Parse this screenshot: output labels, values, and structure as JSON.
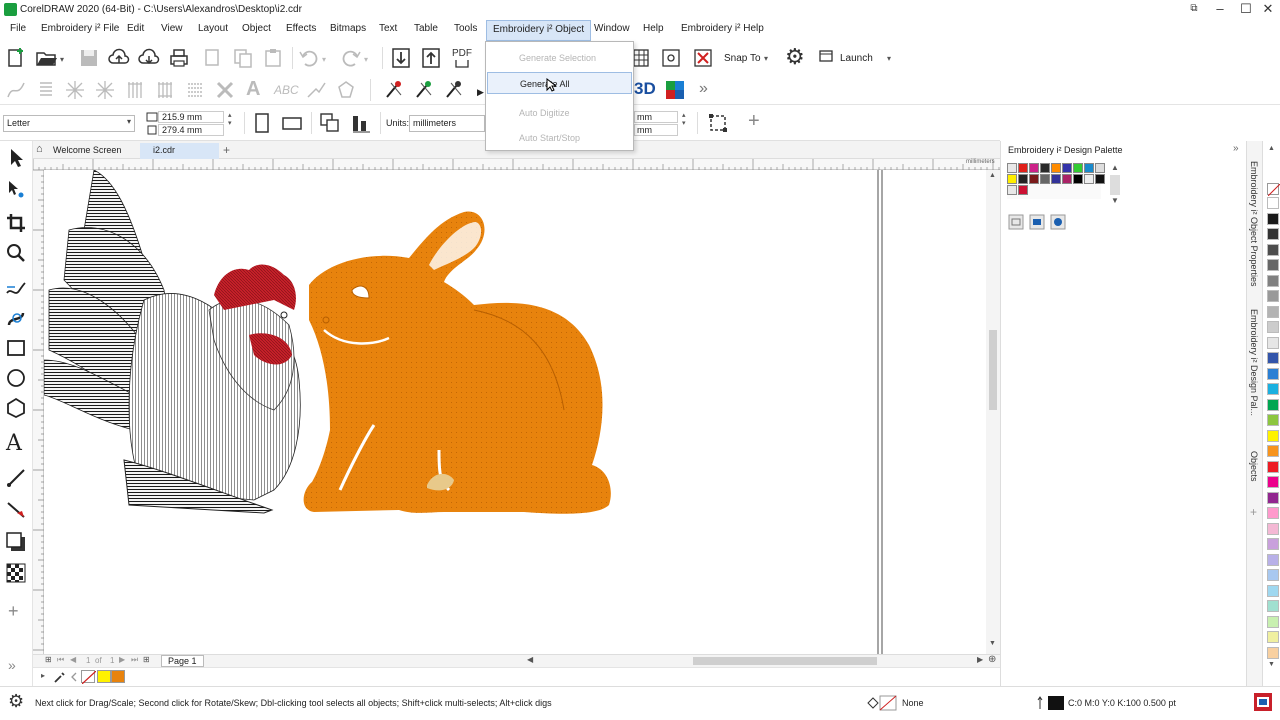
{
  "window": {
    "title": "CorelDRAW 2020 (64-Bit) - C:\\Users\\Alexandros\\Desktop\\i2.cdr",
    "minimize": "–",
    "maximize": "☐",
    "close": "✕"
  },
  "menubar": {
    "items": [
      "File",
      "Embroidery i² File",
      "Edit",
      "View",
      "Layout",
      "Object",
      "Effects",
      "Bitmaps",
      "Text",
      "Table",
      "Tools",
      "Embroidery i² Object",
      "Window",
      "Help",
      "Embroidery i² Help"
    ],
    "active_index": 11
  },
  "toolbar": {
    "pdf_label": "PDF",
    "snap_to": "Snap To",
    "launch": "Launch",
    "label_3d": "3D"
  },
  "dropdown": {
    "items": [
      {
        "label": "Generate Selection",
        "enabled": false
      },
      {
        "label": "Generate All",
        "enabled": true
      },
      {
        "label": "Auto Digitize",
        "enabled": false
      },
      {
        "label": "Auto Start/Stop",
        "enabled": false
      }
    ]
  },
  "propbar": {
    "page_size": "Letter",
    "width": "215.9 mm",
    "height": "279.4 mm",
    "units_label": "Units:",
    "units_value": "millimeters",
    "nudge1": "mm",
    "nudge2": "mm"
  },
  "doc_tabs": {
    "welcome": "Welcome Screen",
    "file": "i2.cdr",
    "add": "+"
  },
  "ruler": {
    "unit_label": "millimeters"
  },
  "page_nav": {
    "current": "1",
    "of": "of",
    "total": "1",
    "page_label": "Page 1"
  },
  "docker": {
    "title": "Embroidery i² Design Palette",
    "swatch_colors": [
      "#e8e8e8",
      "#e0201a",
      "#cc2288",
      "#2a2a2a",
      "#ff8c00",
      "#3333aa",
      "#33cc33",
      "#1a8acc",
      "#dddddd",
      "#ffee00",
      "#222222",
      "#7a1a1a",
      "#666666",
      "#333399",
      "#aa2266",
      "#000000",
      "#eeeeee",
      "#111111",
      "#e8e8e8",
      "#cc1133"
    ]
  },
  "docker_tabs": [
    "Embroidery i² Object Properties",
    "Embroidery i² Design Pal...",
    "Objects"
  ],
  "statusbar": {
    "hint": "Next click for Drag/Scale; Second click for Rotate/Skew; Dbl-clicking tool selects all objects; Shift+click multi-selects; Alt+click digs",
    "fill": "None",
    "outline": "C:0 M:0 Y:0 K:100  0.500 pt"
  },
  "palette_colors": [
    "#ffffff",
    "#1a1a1a",
    "#333333",
    "#4d4d4d",
    "#666666",
    "#808080",
    "#999999",
    "#b3b3b3",
    "#cccccc",
    "#e6e6e6",
    "#3355aa",
    "#2a7fd4",
    "#1ab0e0",
    "#00a651",
    "#8dc63f",
    "#fff200",
    "#f7941d",
    "#ed1c24",
    "#ec008c",
    "#92278f",
    "#ff99cc",
    "#f4b8d4",
    "#c9a0dc",
    "#b8b0e8",
    "#a8c8f0",
    "#9fd8f0",
    "#a0e0d0",
    "#c8f0b0",
    "#f0f0a0",
    "#f8d0a0"
  ],
  "colors": {
    "accent": "#9ebde3",
    "orange": "#e8830d",
    "red": "#c8202a"
  }
}
